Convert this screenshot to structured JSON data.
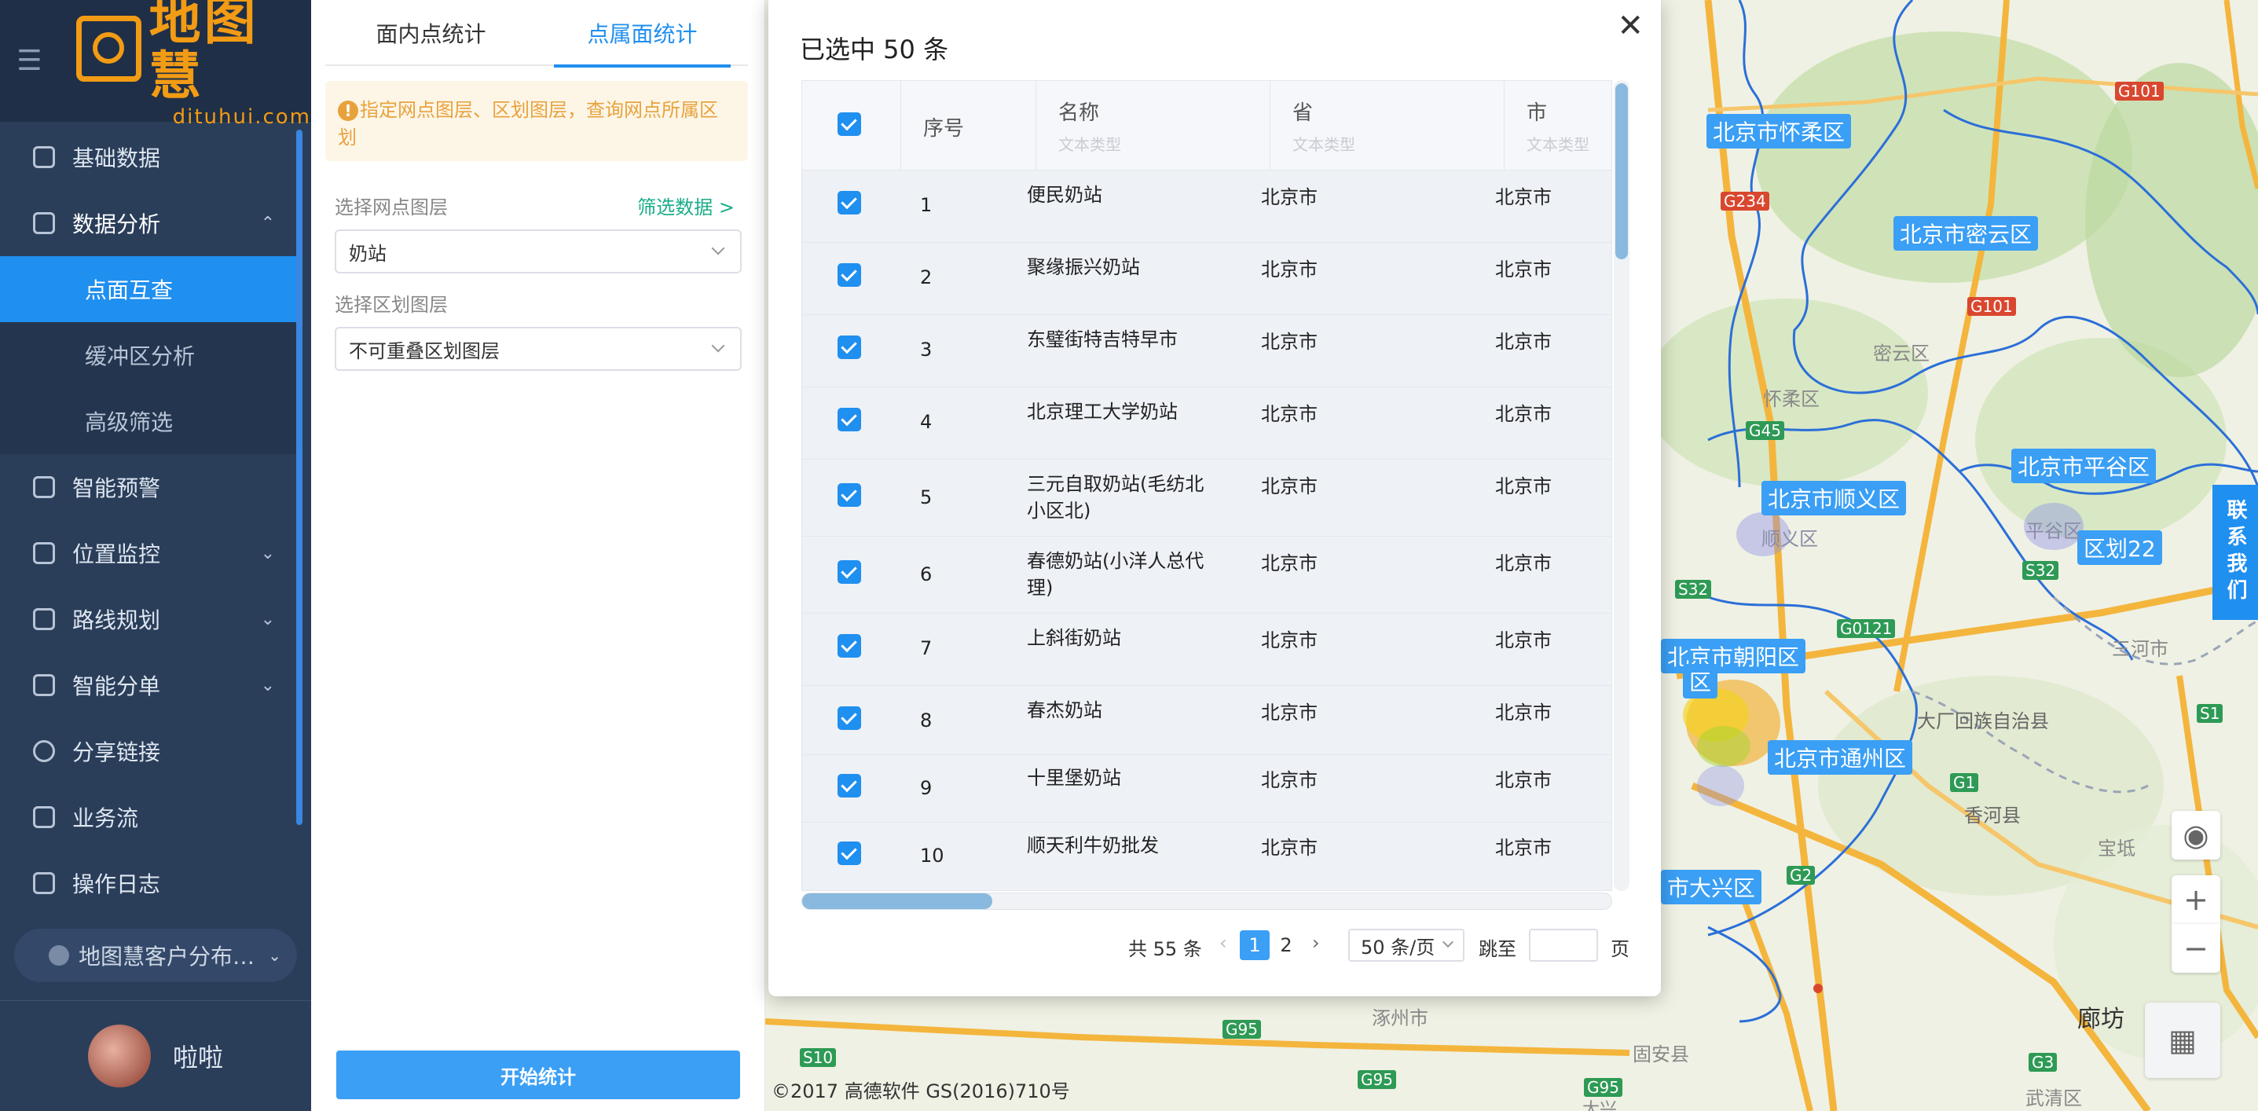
{
  "app": {
    "logo_title": "地图慧",
    "logo_sub": "dituhui.com"
  },
  "sidebar": {
    "items": [
      {
        "label": "基础数据",
        "icon": "database-icon"
      },
      {
        "label": "数据分析",
        "icon": "analysis-icon"
      },
      {
        "label": "智能预警",
        "icon": "alert-icon"
      },
      {
        "label": "位置监控",
        "icon": "location-icon"
      },
      {
        "label": "路线规划",
        "icon": "route-icon"
      },
      {
        "label": "智能分单",
        "icon": "dispatch-icon"
      },
      {
        "label": "分享链接",
        "icon": "share-icon"
      },
      {
        "label": "业务流",
        "icon": "workflow-icon"
      },
      {
        "label": "操作日志",
        "icon": "log-icon"
      }
    ],
    "submenu": [
      {
        "label": "点面互查",
        "active": true
      },
      {
        "label": "缓冲区分析",
        "active": false
      },
      {
        "label": "高级筛选",
        "active": false
      }
    ],
    "org": "地图慧客户分布…",
    "user": "啦啦",
    "accent": "#1f8ff0"
  },
  "panel": {
    "tabs": [
      {
        "label": "面内点统计"
      },
      {
        "label": "点属面统计"
      }
    ],
    "active_tab": 1,
    "notice": "指定网点图层、区划图层，查询网点所属区划",
    "point_layer_label": "选择网点图层",
    "filter_link": "筛选数据 >",
    "point_layer_value": "奶站",
    "region_layer_label": "选择区划图层",
    "region_layer_value": "不可重叠区划图层",
    "start_button": "开始统计"
  },
  "map": {
    "districts": [
      "北京市怀柔区",
      "北京市密云区",
      "北京市平谷区",
      "北京市顺义区",
      "区划22",
      "北京市朝阳区",
      "北京市通州区",
      "市大兴区",
      "区"
    ],
    "places": [
      "密云区",
      "怀柔区",
      "顺义区",
      "平谷区",
      "三河市",
      "大厂回族自治县",
      "香河县",
      "廊坊",
      "涿州市",
      "固安县",
      "武清区",
      "宝坻",
      "大兴"
    ],
    "roads": [
      "G101",
      "G234",
      "G101",
      "G45",
      "S32",
      "G0121",
      "S32",
      "S1",
      "G1",
      "G2",
      "G95",
      "G95",
      "S10",
      "G95",
      "G3"
    ],
    "copyright": "©2017 高德软件 GS(2016)710号",
    "contact": "联系我们"
  },
  "modal": {
    "title": "已选中 50 条",
    "columns": [
      {
        "label": "序号",
        "sub": ""
      },
      {
        "label": "名称",
        "sub": "文本类型"
      },
      {
        "label": "省",
        "sub": "文本类型"
      },
      {
        "label": "市",
        "sub": "文本类型"
      }
    ],
    "rows": [
      {
        "no": "1",
        "name": "便民奶站",
        "province": "北京市",
        "city": "北京市",
        "checked": true
      },
      {
        "no": "2",
        "name": "聚缘振兴奶站",
        "province": "北京市",
        "city": "北京市",
        "checked": true
      },
      {
        "no": "3",
        "name": "东璧街特吉特早市",
        "province": "北京市",
        "city": "北京市",
        "checked": true
      },
      {
        "no": "4",
        "name": "北京理工大学奶站",
        "province": "北京市",
        "city": "北京市",
        "checked": true
      },
      {
        "no": "5",
        "name": "三元自取奶站(毛纺北小区北)",
        "province": "北京市",
        "city": "北京市",
        "checked": true
      },
      {
        "no": "6",
        "name": "春德奶站(小洋人总代理)",
        "province": "北京市",
        "city": "北京市",
        "checked": true
      },
      {
        "no": "7",
        "name": "上斜街奶站",
        "province": "北京市",
        "city": "北京市",
        "checked": true
      },
      {
        "no": "8",
        "name": "春杰奶站",
        "province": "北京市",
        "city": "北京市",
        "checked": true
      },
      {
        "no": "9",
        "name": "十里堡奶站",
        "province": "北京市",
        "city": "北京市",
        "checked": true
      },
      {
        "no": "10",
        "name": "顺天利牛奶批发",
        "province": "北京市",
        "city": "北京市",
        "checked": true
      }
    ],
    "pagination": {
      "total": "共 55 条",
      "pages": [
        "1",
        "2"
      ],
      "current": "1",
      "size": "50 条/页",
      "jump": "跳至",
      "page": "页",
      "prev": "‹",
      "next": "›"
    }
  }
}
